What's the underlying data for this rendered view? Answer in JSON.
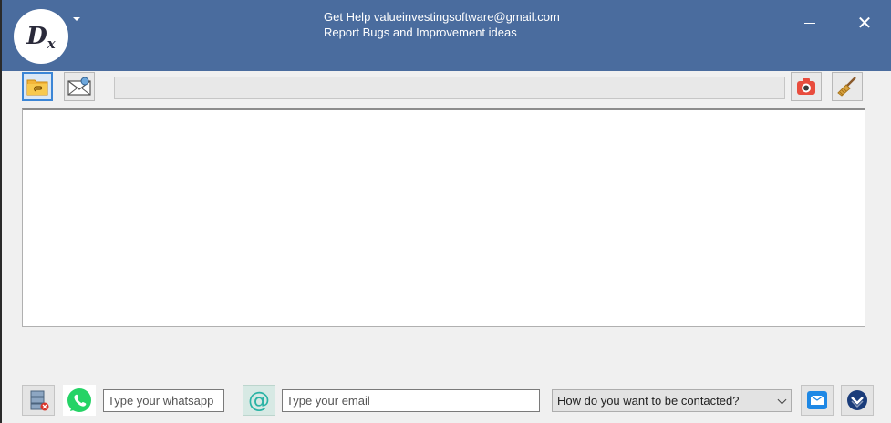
{
  "titlebar": {
    "logo_letter": "D",
    "logo_sub": "x",
    "help_line": "Get Help valueinvestingsoftware@gmail.com",
    "report_line": "Report Bugs and Improvement ideas",
    "minimize_symbol": "—",
    "close_symbol": "✕",
    "color": "#4a6c9e"
  },
  "toolbar": {
    "left_buttons": [
      "folder-attachment-icon",
      "email-attachment-icon"
    ],
    "path_value": "",
    "right_buttons": [
      "camera-icon",
      "broom-icon"
    ]
  },
  "message": {
    "value": ""
  },
  "contact": {
    "whatsapp_placeholder": "Type your whatsapp",
    "email_placeholder": "Type your email",
    "method_selected": "How do you want to be contacted?",
    "icons": [
      "server-delete-icon",
      "whatsapp-icon",
      "at-sign-icon",
      "send-email-icon",
      "submit-check-icon"
    ]
  }
}
